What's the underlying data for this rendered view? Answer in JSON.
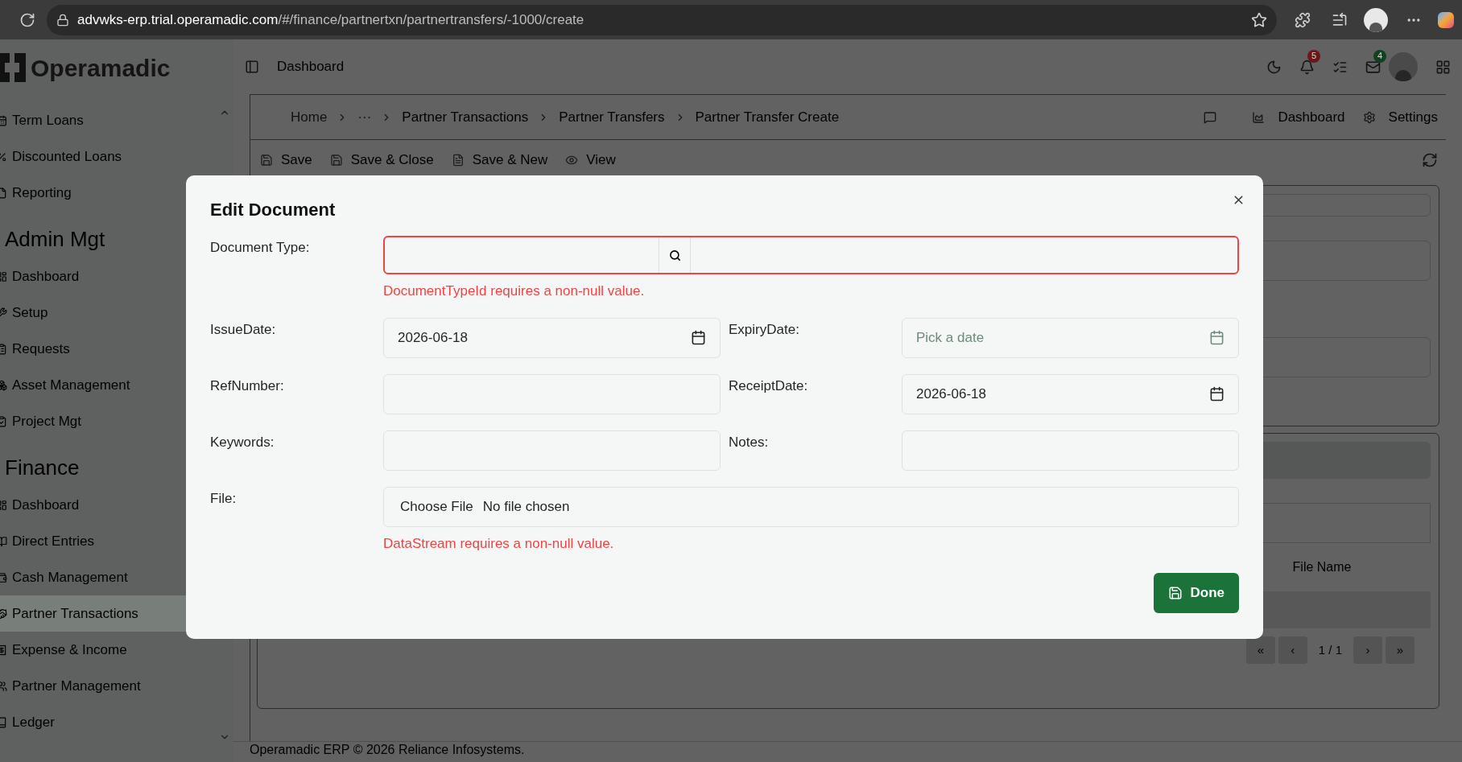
{
  "browser": {
    "url_host": "advwks-erp.trial.operamadic.com",
    "url_path": "/#/finance/partnertxn/partnertransfers/-1000/create"
  },
  "sidebar": {
    "logo": "Operamadic",
    "sections": [
      {
        "items": [
          {
            "label": "Term Loans",
            "selected": false
          },
          {
            "label": "Discounted Loans",
            "selected": false
          },
          {
            "label": "Reporting",
            "selected": false
          }
        ]
      },
      {
        "title": "Admin Mgt",
        "items": [
          {
            "label": "Dashboard",
            "selected": false
          },
          {
            "label": "Setup",
            "selected": false
          },
          {
            "label": "Requests",
            "selected": false
          },
          {
            "label": "Asset Management",
            "selected": false
          },
          {
            "label": "Project Mgt",
            "selected": false
          }
        ]
      },
      {
        "title": "Finance",
        "items": [
          {
            "label": "Dashboard",
            "selected": false
          },
          {
            "label": "Direct Entries",
            "selected": false
          },
          {
            "label": "Cash Management",
            "selected": false
          },
          {
            "label": "Partner Transactions",
            "selected": true
          },
          {
            "label": "Expense & Income",
            "selected": false
          },
          {
            "label": "Partner Management",
            "selected": false
          },
          {
            "label": "Ledger",
            "selected": false
          }
        ]
      }
    ]
  },
  "header": {
    "title": "Dashboard",
    "notifications_badge": "5",
    "mail_badge": "4"
  },
  "breadcrumb": [
    "Home",
    "···",
    "Partner Transactions",
    "Partner Transfers",
    "Partner Transfer Create"
  ],
  "header_links": [
    "Dashboard",
    "Settings"
  ],
  "toolbar": [
    "Save",
    "Save & Close",
    "Save & New",
    "View"
  ],
  "table": {
    "column": "File Name"
  },
  "pagination": [
    "«",
    "‹",
    "1 / 1",
    "›",
    "»"
  ],
  "footer": "Operamadic ERP © 2026 Reliance Infosystems.",
  "modal": {
    "title": "Edit Document",
    "fields": [
      {
        "kind": "lookup",
        "label": "Document Type:",
        "invalid": true,
        "error": "DocumentTypeId requires a non-null value."
      },
      {
        "kind": "date",
        "label": "IssueDate:",
        "value": "2026-06-18"
      },
      {
        "kind": "date",
        "label": "ExpiryDate:",
        "placeholder": "Pick a date"
      },
      {
        "kind": "text",
        "label": "RefNumber:"
      },
      {
        "kind": "date",
        "label": "ReceiptDate:",
        "value": "2026-06-18"
      },
      {
        "kind": "text",
        "label": "Keywords:"
      },
      {
        "kind": "text",
        "label": "Notes:"
      },
      {
        "kind": "file",
        "label": "File:",
        "button": "Choose File",
        "status": "No file chosen",
        "invalid": false,
        "error": "DataStream requires a non-null value."
      }
    ],
    "done": "Done"
  }
}
